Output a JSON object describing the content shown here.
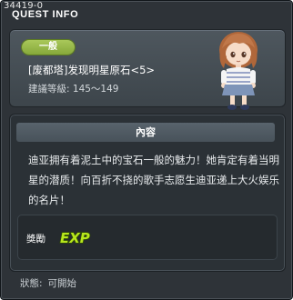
{
  "window": {
    "quest_id": "34419-0",
    "title": "QUEST INFO"
  },
  "quest": {
    "category": "一般",
    "name": "[废都塔]发现明星原石<5>",
    "level_label": "建議等級:",
    "level_range": "145～149"
  },
  "content": {
    "header": "內容",
    "description": "迪亚拥有着泥土中的宝石一般的魅力！她肯定有着当明星的潜质！向百折不挠的歌手志愿生迪亚递上大火娱乐的名片！"
  },
  "reward": {
    "label": "獎勵",
    "items": [
      "EXP"
    ]
  },
  "status": {
    "label": "狀態:",
    "value": "可開始"
  },
  "colors": {
    "category_badge": "#96b848",
    "exp_icon": "#b7e61c",
    "window_bg": "#2e3338"
  }
}
